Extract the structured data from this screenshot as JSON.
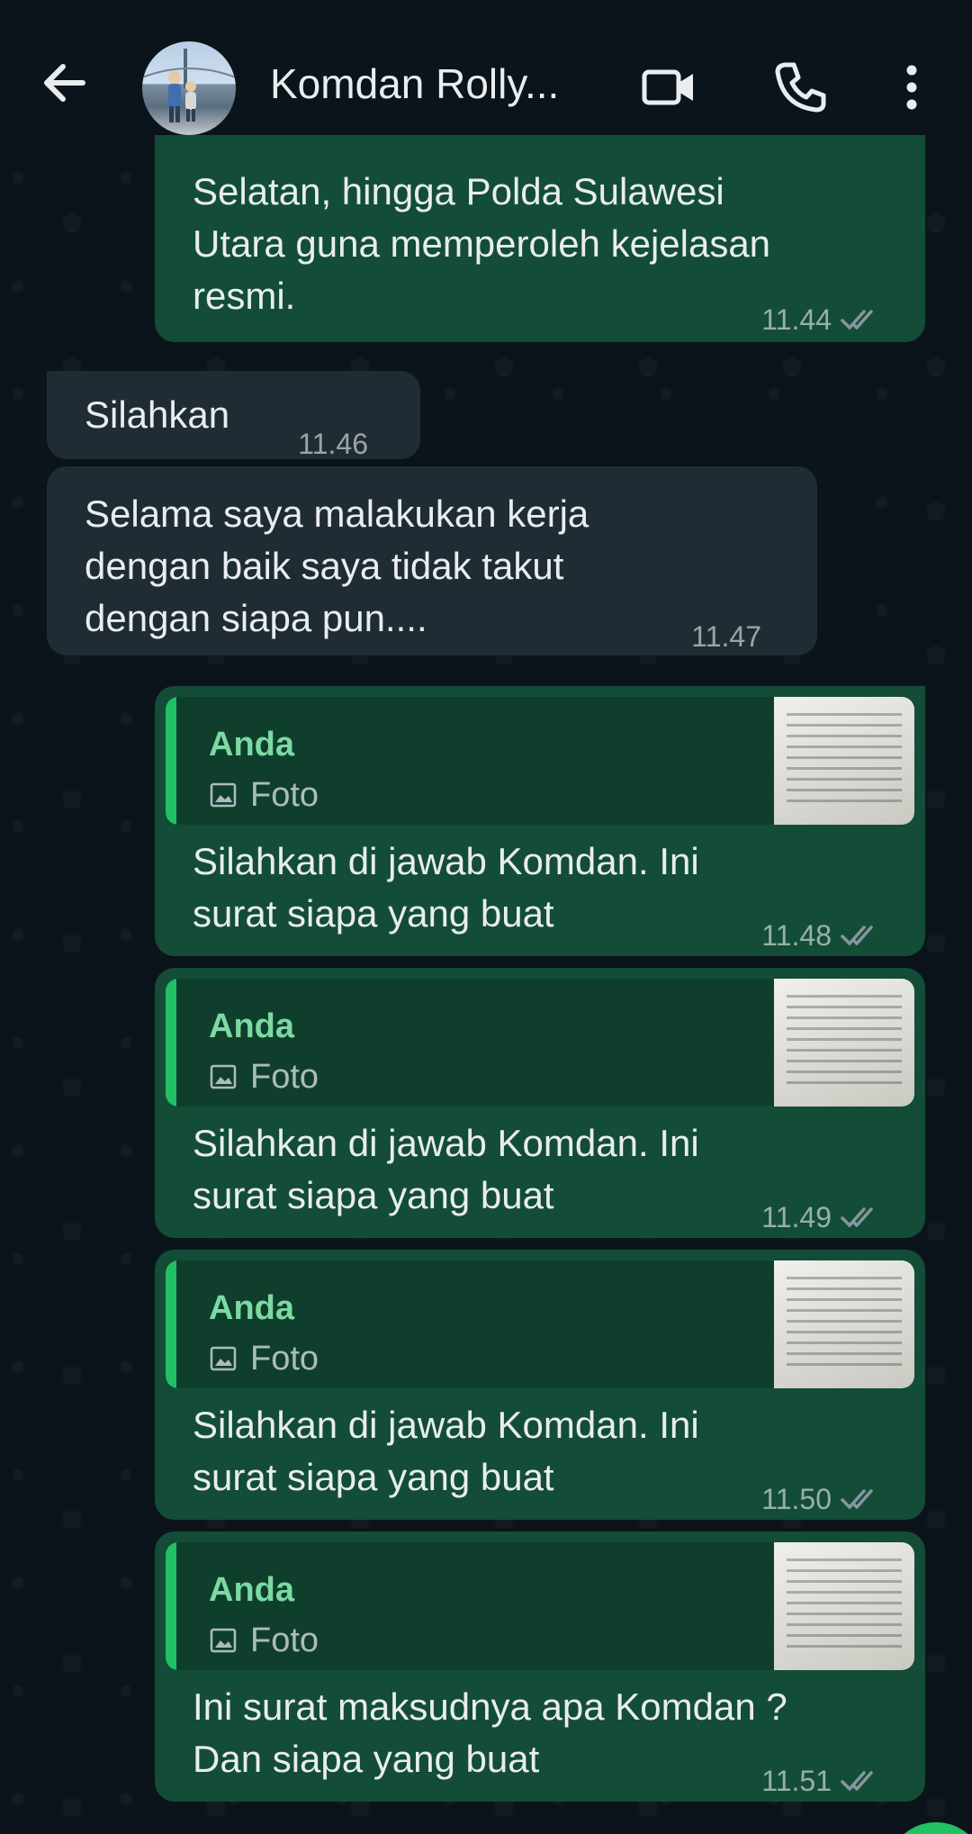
{
  "header": {
    "contact_name": "Komdan Rolly...",
    "back_icon": "arrow-left-icon",
    "video_icon": "video-call-icon",
    "call_icon": "phone-icon",
    "menu_icon": "more-vertical-icon"
  },
  "messages": [
    {
      "direction": "out",
      "text": "Selatan, hingga Polda Sulawesi\nUtara guna memperoleh kejelasan\nresmi.",
      "time": "11.44",
      "status": "read"
    },
    {
      "direction": "in",
      "text": "Silahkan",
      "time": "11.46"
    },
    {
      "direction": "in",
      "text": "Selama saya malakukan kerja\ndengan baik saya tidak takut\ndengan siapa pun....",
      "time": "11.47"
    },
    {
      "direction": "out",
      "quote_author": "Anda",
      "quote_type": "Foto",
      "text": "Silahkan di jawab Komdan. Ini\nsurat siapa yang buat",
      "time": "11.48",
      "status": "read"
    },
    {
      "direction": "out",
      "quote_author": "Anda",
      "quote_type": "Foto",
      "text": "Silahkan di jawab Komdan. Ini\nsurat siapa yang buat",
      "time": "11.49",
      "status": "read"
    },
    {
      "direction": "out",
      "quote_author": "Anda",
      "quote_type": "Foto",
      "text": "Silahkan di jawab Komdan. Ini\nsurat siapa yang buat",
      "time": "11.50",
      "status": "read"
    },
    {
      "direction": "out",
      "quote_author": "Anda",
      "quote_type": "Foto",
      "text": "Ini surat maksudnya apa Komdan ?\nDan siapa yang buat",
      "time": "11.51",
      "status": "read"
    }
  ],
  "colors": {
    "background": "#0b141a",
    "outgoing_bubble": "#134d37",
    "incoming_bubble": "#202c33",
    "accent": "#21c063",
    "read_ticks": "#8696a0"
  }
}
